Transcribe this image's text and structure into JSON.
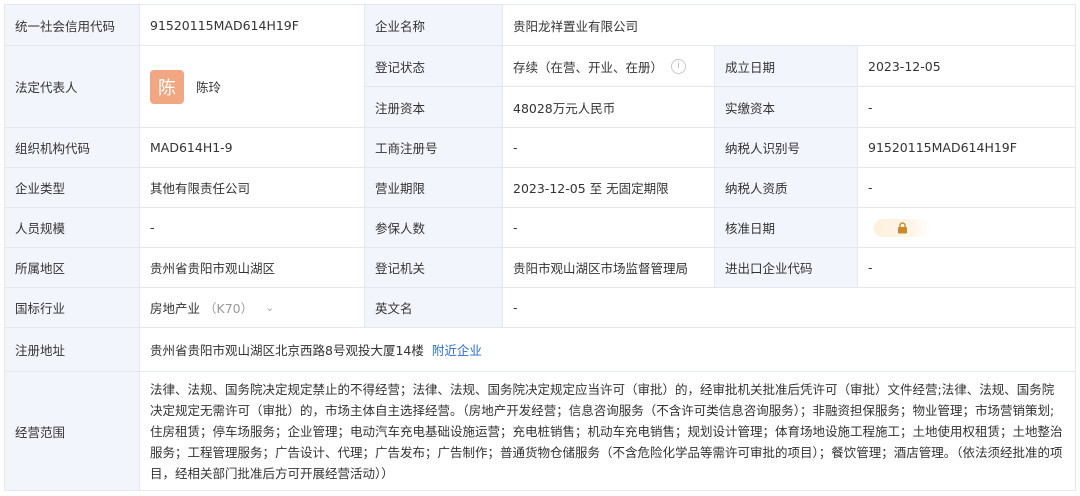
{
  "rows": {
    "credit_code": {
      "label": "统一社会信用代码",
      "value": "91520115MAD614H19F"
    },
    "company_name": {
      "label": "企业名称",
      "value": "贵阳龙祥置业有限公司"
    },
    "legal_rep": {
      "label": "法定代表人",
      "avatar_char": "陈",
      "name": "陈玲"
    },
    "reg_status": {
      "label": "登记状态",
      "value": "存续（在营、开业、在册）",
      "info_icon": "info-circle-icon"
    },
    "est_date": {
      "label": "成立日期",
      "value": "2023-12-05"
    },
    "reg_capital": {
      "label": "注册资本",
      "value": "48028万元人民币"
    },
    "paid_capital": {
      "label": "实缴资本",
      "value": "-"
    },
    "org_code": {
      "label": "组织机构代码",
      "value": "MAD614H1-9"
    },
    "biz_reg_no": {
      "label": "工商注册号",
      "value": "-"
    },
    "taxpayer_id": {
      "label": "纳税人识别号",
      "value": "91520115MAD614H19F"
    },
    "company_type": {
      "label": "企业类型",
      "value": "其他有限责任公司"
    },
    "biz_term": {
      "label": "营业期限",
      "value": "2023-12-05 至 无固定期限"
    },
    "taxpayer_qual": {
      "label": "纳税人资质",
      "value": "-"
    },
    "staff_size": {
      "label": "人员规模",
      "value": "-"
    },
    "insured": {
      "label": "参保人数",
      "value": "-"
    },
    "approval_date": {
      "label": "核准日期",
      "lock_icon": "lock-icon"
    },
    "region": {
      "label": "所属地区",
      "value": "贵州省贵阳市观山湖区"
    },
    "reg_authority": {
      "label": "登记机关",
      "value": "贵阳市观山湖区市场监督管理局"
    },
    "ie_code": {
      "label": "进出口企业代码",
      "value": "-"
    },
    "industry": {
      "label": "国标行业",
      "value": "房地产业",
      "code": "（K70）",
      "chevron_icon": "chevron-down-icon"
    },
    "english_name": {
      "label": "英文名",
      "value": "-"
    },
    "address": {
      "label": "注册地址",
      "value": "贵州省贵阳市观山湖区北京西路8号观投大厦14楼",
      "link": "附近企业"
    },
    "scope": {
      "label": "经营范围",
      "value": "法律、法规、国务院决定规定禁止的不得经营；法律、法规、国务院决定规定应当许可（审批）的，经审批机关批准后凭许可（审批）文件经营;法律、法规、国务院决定规定无需许可（审批）的，市场主体自主选择经营。（房地产开发经营；信息咨询服务（不含许可类信息咨询服务）；非融资担保服务；物业管理；市场营销策划;住房租赁；停车场服务；企业管理；电动汽车充电基础设施运营；充电桩销售；机动车充电销售；规划设计管理；体育场地设施工程施工；土地使用权租赁；土地整治服务；工程管理服务；广告设计、代理；广告发布；广告制作；普通货物仓储服务（不含危险化学品等需许可审批的项目）；餐饮管理；酒店管理。（依法须经批准的项目，经相关部门批准后方可开展经营活动））"
    }
  },
  "colors": {
    "label_bg": "#f2f6fc",
    "border": "#e4e7ec",
    "link": "#2b6ed7",
    "avatar_bg": "#f2a783",
    "lock": "#c98a2b"
  }
}
